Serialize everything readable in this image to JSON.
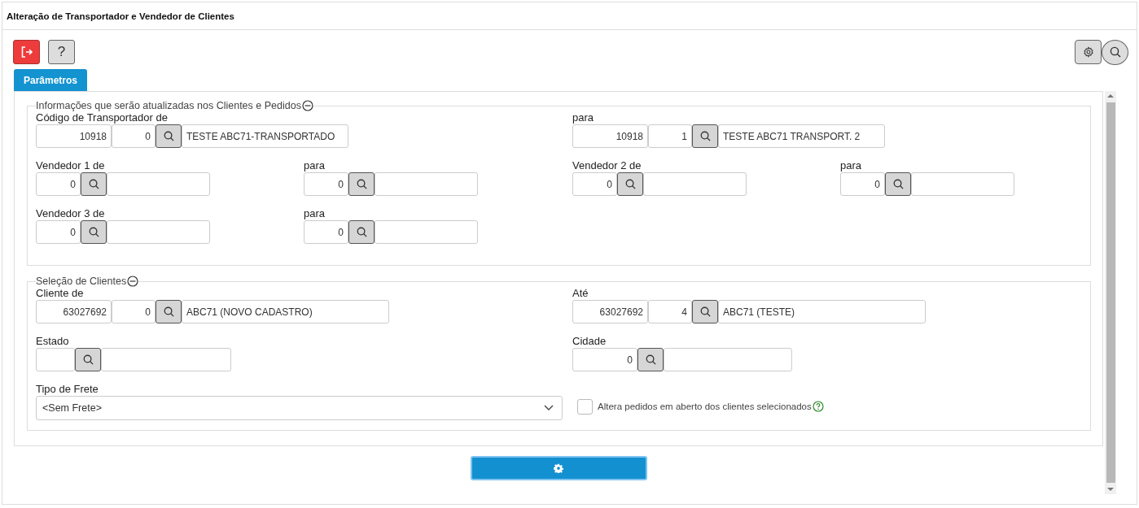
{
  "window": {
    "title": "Alteração de Transportador e Vendedor de Clientes"
  },
  "help_button": {
    "label": "?"
  },
  "tabs": [
    {
      "label": "Parâmetros",
      "selected": true
    }
  ],
  "sections": [
    {
      "legend": "Informações que serão atualizadas nos Clientes e Pedidos",
      "fields": [
        {
          "kind": "carrier",
          "label": "Código de Transportador de",
          "code": "10918",
          "seq": "0",
          "description": "TESTE ABC71-TRANSPORTADO"
        },
        {
          "kind": "carrier",
          "label": "para",
          "code": "10918",
          "seq": "1",
          "description": "TESTE ABC71 TRANSPORT. 2"
        },
        {
          "kind": "seller",
          "label": "Vendedor 1 de",
          "code": "0"
        },
        {
          "kind": "seller",
          "label": "para",
          "code": "0"
        },
        {
          "kind": "seller",
          "label": "Vendedor 2 de",
          "code": "0"
        },
        {
          "kind": "seller",
          "label": "para",
          "code": "0"
        },
        {
          "kind": "seller",
          "label": "Vendedor 3 de",
          "code": "0"
        },
        {
          "kind": "seller",
          "label": "para",
          "code": "0"
        }
      ]
    },
    {
      "legend": "Seleção de Clientes",
      "fields": [
        {
          "kind": "client",
          "label": "Cliente de",
          "code": "63027692",
          "seq": "0",
          "description": "ABC71 (NOVO CADASTRO)"
        },
        {
          "kind": "client",
          "label": "Até",
          "code": "63027692",
          "seq": "4",
          "description": "ABC71 (TESTE)"
        },
        {
          "kind": "state",
          "label": "Estado"
        },
        {
          "kind": "city",
          "label": "Cidade",
          "code": "0"
        }
      ],
      "freight": {
        "label": "Tipo de Frete",
        "value": "<Sem Frete>"
      },
      "option": {
        "label": "Altera pedidos em aberto dos clientes selecionados",
        "checked": false
      }
    }
  ]
}
